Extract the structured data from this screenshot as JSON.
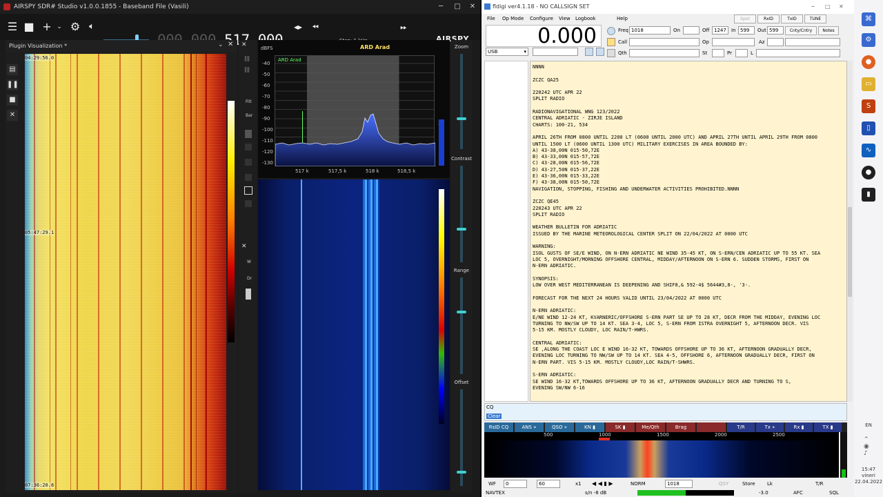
{
  "airspy": {
    "title": "AIRSPY SDR# Studio v1.0.0.1855 - Baseband File (Vasili)",
    "freq_dim": "000.000.",
    "freq_bright": "517.000",
    "step": "Step: 1 kHz",
    "logo": "AIRSPY",
    "plugin_title": "Plugin Visualization *",
    "timestamps": [
      "04:29:56.0",
      "05:47:29.1",
      "07:36:20.8"
    ],
    "spectrum": {
      "unit": "dBFS",
      "station": "ARD Arad",
      "marker_label": "ARD Arad",
      "y_ticks": [
        "-40",
        "-50",
        "-60",
        "-70",
        "-80",
        "-90",
        "-100",
        "-110",
        "-120",
        "-130"
      ],
      "x_ticks": [
        "517 k",
        "517,5 k",
        "518 k",
        "518,5 k"
      ],
      "level": "34"
    },
    "controls": {
      "zoom": "Zoom",
      "contrast": "Contrast",
      "range": "Range",
      "offset": "Offset"
    },
    "mid_labels": {
      "filter": "Filt",
      "bar": "Bar",
      "w": "W",
      "dr": "Dr"
    }
  },
  "fldigi": {
    "title": "fldigi ver4.1.18 - NO CALLSIGN SET",
    "menu": [
      "File",
      "Op Mode",
      "Configure",
      "View",
      "Logbook",
      "Help"
    ],
    "top_buttons": [
      "Spot",
      "RxID",
      "TxID",
      "TUNE"
    ],
    "freq_display": "0.000",
    "mode": "USB",
    "fields": {
      "freq_label": "Freq",
      "freq_value": "1018",
      "on_label": "On",
      "off_label": "Off",
      "off_value": "1247",
      "in_label": "In",
      "in_value": "599",
      "out_label": "Out",
      "out_value": "599",
      "cnty": "Cnty/Cntry",
      "notes": "Notes",
      "call": "Call",
      "op": "Op",
      "az": "Az",
      "qth": "Qth",
      "st": "St",
      "pr": "Pr",
      "l": "L"
    },
    "rx_text": "NNNN\n\nZCZC QA25\n\n220242 UTC APR 22\nSPLIT RADIO\n\nRADIONAVIGATIONAL WNG 123/2022\nCENTRAL ADRIATIC - ZIRJE ISLAND\nCHARTS: 100-21, 534\n\nAPRIL 26TH FROM 0800 UNTIL 2200 LT (0600 UNTIL 2000 UTC) AND APRIL 27TH UNTIL APRIL 29TH FROM 0800\nUNTIL 1500 LT (0600 UNTIL 1300 UTC) MILITARY EXERCISES IN AREA BOUNDED BY:\nA) 43-38,00N 015-50,72E\nB) 43-33,00N 015-57,72E\nC) 43-28,00N 015-56,72E\nD) 43-27,50N 015-37,22E\nE) 43-36,00N 015-33,22E\nF) 43-38,00N 015-50,72E\nNAVIGATION, STOPPING, FISHING AND UNDERWATER ACTIVITIES PROHIBITED.NNNN\n\nZCZC QE45\n220243 UTC APR 22\nSPLIT RADIO\n\nWEATHER BULLETIN FOR ADRIATIC\nISSUED BY THE MARINE METEOROLOGICAL CENTER SPLIT ON 22/04/2022 AT 0000 UTC\n\nWARNING:\nISOL GUSTS OF SE/E WIND, ON N-ERN ADRIATIC NE WIND 35-45 KT, ON S-ERN/CEN ADRIATIC UP TO 55 KT. SEA\nLOC 5, OVERNIGHT/MORNING OFFSHORE CENTRAL, MIDDAY/AFTERNOON ON S-ERN 6. SUDDEN STORMS, FIRST ON\nN-ERN ADRIATIC.\n\nSYNOPSIS:\nLOW OVER WEST MEDITERRANEAN IS DEEPENING AND SHIF8,& 592-4$ 5644#3,8-, '3-.\n\nFORECAST FOR THE NEXT 24 HOURS VALID UNTIL 23/04/2022 AT 0000 UTC\n\nN-ERN ADRIATIC:\nE/NE WIND 12-24 KT, KVARNERIC/OFFSHORE S-ERN PART SE UP TO 28 KT, DECR FROM THE MIDDAY, EVENING LOC\nTURNING TO NW/SW UP TO 14 KT. SEA 3-4, LOC 5, S-ERN FROM ISTRA OVERNIGHT 5, AFTERNOON DECR. VIS\n5-15 KM. MOSTLY CLOUDY, LOC RAIN/T-HWRS.\n\nCENTRAL ADRIATIC:\nSE ,ALONG THE COAST LOC E WIND 16-32 KT, TOWARDS OFFSHORE UP TO 36 KT, AFTERNOON GRADUALLY DECR,\nEVENING LOC TURNING TO NW/SW UP TO 14 KT. SEA 4-5, OFFSHORE 6, AFTERNOON GRADUALLY DECR, FIRST ON\nN-ERN PART. VIS 5-15 KM. MOSTLY CLOUDY,LOC RAIN/T-SHWRS.\n\nS-ERN ADRIATIC:\nSE WIND 16-32 KT,TOWARDS OFFSHORE UP TO 36 KT, AFTERNOON GRADUALLY DECR AND TURNING TO S,\nEVENING SW/NW 6-16",
    "tx_label": "CQ",
    "tx_clear": "Clear",
    "macros": [
      {
        "label": "RsID CQ",
        "color": "#2a6a9a"
      },
      {
        "label": "ANS »",
        "color": "#2a6a9a"
      },
      {
        "label": "QSO »",
        "color": "#2a6a9a"
      },
      {
        "label": "KN ▮",
        "color": "#2a6a9a"
      },
      {
        "label": "SK ▮",
        "color": "#8a2a2a"
      },
      {
        "label": "Me/Qth",
        "color": "#8a2a2a"
      },
      {
        "label": "Brag",
        "color": "#8a2a2a"
      },
      {
        "label": "",
        "color": "#8a2a2a"
      },
      {
        "label": "T/R",
        "color": "#2a3a8a"
      },
      {
        "label": "Tx »",
        "color": "#2a3a8a"
      },
      {
        "label": "Rx ▮",
        "color": "#2a3a8a"
      },
      {
        "label": "TX ▮",
        "color": "#2a3a8a"
      }
    ],
    "wf_scale": [
      "500",
      "1000",
      "1500",
      "2000",
      "2500"
    ],
    "bottom": {
      "wf": "WF",
      "v0": "0",
      "v60": "60",
      "x1": "x1",
      "norm": "NORM",
      "freq": "1018",
      "qsy": "QSY",
      "store": "Store",
      "lk": "Lk",
      "tr": "T/R"
    },
    "status": {
      "mode": "NAVTEX",
      "sn": "s/n  -8 dB",
      "level": "-3.0",
      "afc": "AFC",
      "sql": "SQL"
    }
  },
  "taskbar": {
    "lang": "EN",
    "time": "15:47",
    "day": "vineri",
    "date": "22.04.2022"
  }
}
